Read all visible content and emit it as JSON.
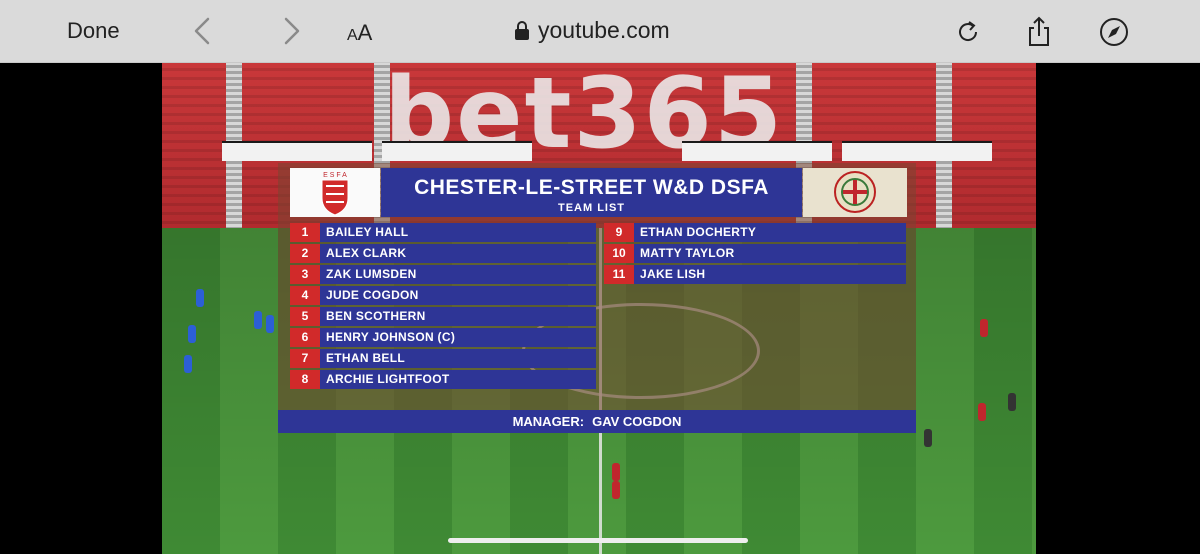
{
  "browser": {
    "done_label": "Done",
    "text_size_label_small": "A",
    "text_size_label_large": "A",
    "url": "youtube.com",
    "icons": [
      "back-chevron-icon",
      "forward-chevron-icon",
      "lock-icon",
      "reload-icon",
      "share-icon",
      "compass-icon"
    ]
  },
  "video": {
    "stadium_branding": "bet365",
    "graphic": {
      "title": "CHESTER-LE-STREET W&D DSFA",
      "subtitle": "TEAM LIST",
      "left_crest_text": "E S F A",
      "players_left": [
        {
          "number": "1",
          "name": "BAILEY HALL"
        },
        {
          "number": "2",
          "name": "ALEX CLARK"
        },
        {
          "number": "3",
          "name": "ZAK LUMSDEN"
        },
        {
          "number": "4",
          "name": "JUDE COGDON"
        },
        {
          "number": "5",
          "name": "BEN SCOTHERN"
        },
        {
          "number": "6",
          "name": "HENRY JOHNSON (C)"
        },
        {
          "number": "7",
          "name": "ETHAN BELL"
        },
        {
          "number": "8",
          "name": "ARCHIE LIGHTFOOT"
        }
      ],
      "players_right": [
        {
          "number": "9",
          "name": "ETHAN DOCHERTY"
        },
        {
          "number": "10",
          "name": "MATTY TAYLOR"
        },
        {
          "number": "11",
          "name": "JAKE LISH"
        }
      ],
      "manager_label": "MANAGER:",
      "manager_name": "GAV COGDON"
    },
    "colors": {
      "panel_blue": "#2e3596",
      "number_red": "#d12a2a"
    }
  }
}
